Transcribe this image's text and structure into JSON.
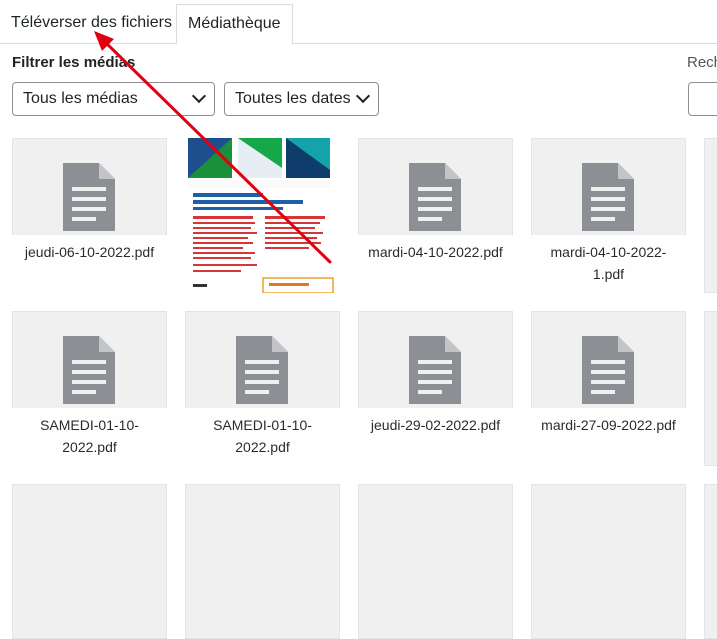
{
  "tabs": {
    "upload": "Téléverser des fichiers",
    "library": "Médiathèque"
  },
  "filters": {
    "label": "Filtrer les médias",
    "type_select": "Tous les médias",
    "date_select": "Toutes les dates"
  },
  "search": {
    "label": "Rech"
  },
  "items": [
    {
      "type": "pdf",
      "name": "jeudi-06-10-2022.pdf"
    },
    {
      "type": "image",
      "name": ""
    },
    {
      "type": "pdf",
      "name": "mardi-04-10-2022.pdf"
    },
    {
      "type": "pdf",
      "name": "mardi-04-10-2022-1.pdf"
    },
    {
      "type": "pdf",
      "name": "SAMEDI-01-10-2022.pdf"
    },
    {
      "type": "pdf",
      "name": "SAMEDI-01-10-2022.pdf"
    },
    {
      "type": "pdf",
      "name": "jeudi-29-02-2022.pdf"
    },
    {
      "type": "pdf",
      "name": "mardi-27-09-2022.pdf"
    }
  ],
  "colors": {
    "annotation_arrow": "#e0000f",
    "tile_bg": "#f0f0f1",
    "doc_icon": "#8c8f94"
  }
}
